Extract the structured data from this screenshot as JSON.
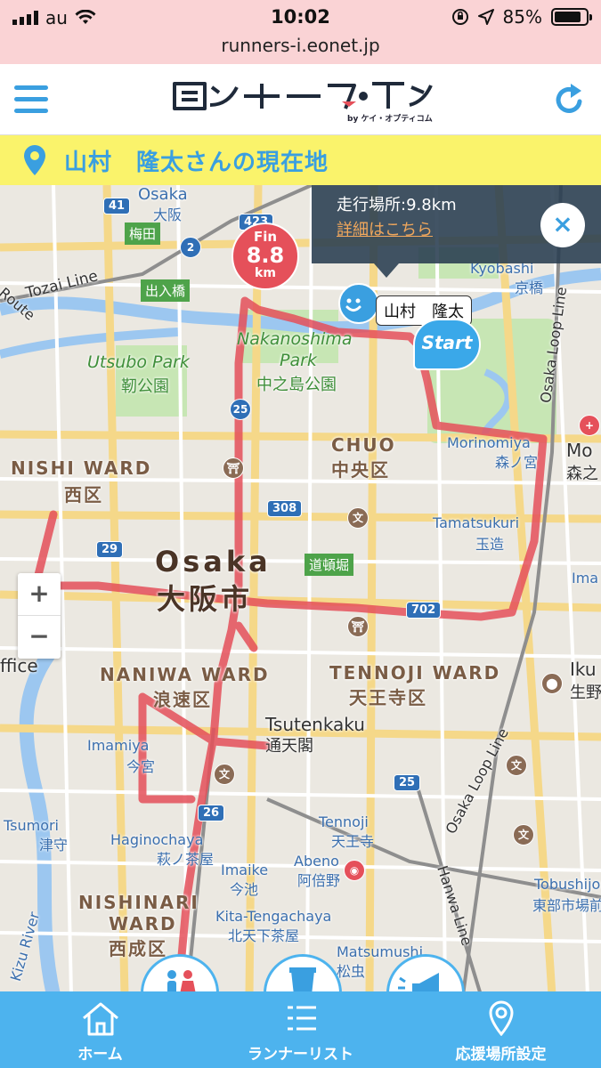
{
  "status": {
    "carrier": "au",
    "time": "10:02",
    "battery": "85%"
  },
  "browser": {
    "url": "runners-i.eonet.jp"
  },
  "header": {
    "logo": "ランナーズ・アイ",
    "logo_sub": "by ケイ・オプティコム"
  },
  "banner": {
    "title": "山村　隆太さんの現在地"
  },
  "map": {
    "info": {
      "location": "走行場所:9.8km",
      "detail_link": "詳細はこちら",
      "close": "×"
    },
    "finish": {
      "label": "Fin",
      "distance": "8.8",
      "unit": "km"
    },
    "runner": {
      "name": "山村　隆太"
    },
    "start": {
      "label": "Start"
    },
    "zoom": {
      "in": "+",
      "out": "−"
    },
    "labels": {
      "osaka_en": "Osaka",
      "osaka_ja": "大阪",
      "tozai": "Tozai Line",
      "umeda": "梅田",
      "deiribashi": "出入橋",
      "route": "Route",
      "nakanoshima_en1": "Nakanoshima",
      "nakanoshima_en2": "Park",
      "nakanoshima_ja": "中之島公園",
      "utsubo_en": "Utsubo Park",
      "utsubo_ja": "靭公園",
      "kyobashi_en": "Kyobashi",
      "kyobashi_ja": "京橋",
      "loop1": "Osaka Loop Line",
      "loop2": "Osaka Loop Line",
      "nishi_en": "NISHI WARD",
      "nishi_ja": "西区",
      "chuo_en": "CHUO",
      "chuo_ja": "中央区",
      "morinomiya_en": "Morinomiya",
      "morinomiya_ja": "森ノ宮",
      "mo_en": "Mo",
      "mo_ja": "森之",
      "tamatsukuri_en": "Tamatsukuri",
      "tamatsukuri_ja": "玉造",
      "dotonbori": "道頓堀",
      "city_en": "Osaka",
      "city_ja": "大阪市",
      "ima": "Ima",
      "naniwa_en": "NANIWA WARD",
      "naniwa_ja": "浪速区",
      "tennoji_en": "TENNOJI WARD",
      "tennoji_ja": "天王寺区",
      "iku_en": "Iku",
      "iku_ja": "生野",
      "ffice": "ffice",
      "tsutenkaku_en": "Tsutenkaku",
      "tsutenkaku_ja": "通天閣",
      "imamiya_en": "Imamiya",
      "imamiya_ja": "今宮",
      "tsumori_en": "Tsumori",
      "tsumori_ja": "津守",
      "haginochaya_en": "Haginochaya",
      "haginochaya_ja": "萩ノ茶屋",
      "tennoji_st_en": "Tennoji",
      "tennoji_st_ja": "天王寺",
      "abeno_en": "Abeno",
      "abeno_ja": "阿倍野",
      "imaike_en": "Imaike",
      "imaike_ja": "今池",
      "hanwa": "Hanwa Line",
      "tobushi_en": "Tobushijomae",
      "tobushi_ja": "東部市場前",
      "nishinari_en1": "NISHINARI",
      "nishinari_en2": "WARD",
      "nishinari_ja": "西成区",
      "kita_en": "Kita-Tengachaya",
      "kita_ja": "北天下茶屋",
      "matsumushi_en": "Matsumushi",
      "matsumushi_ja": "松虫",
      "kizu": "Kizu River"
    },
    "shields": {
      "r41": "41",
      "r2": "2",
      "r423": "423",
      "r25a": "25",
      "r308": "308",
      "r29": "29",
      "r702": "702",
      "r25b": "25",
      "r26": "26"
    }
  },
  "bottom_nav": {
    "home": "ホーム",
    "runner_list": "ランナーリスト",
    "support_settings": "応援場所設定"
  },
  "colors": {
    "accent": "#3a9fe0",
    "banner_bg": "#faf36b",
    "route": "#e5505a",
    "nav_bg": "#4db3ee",
    "status_bg": "#fad3d5"
  }
}
